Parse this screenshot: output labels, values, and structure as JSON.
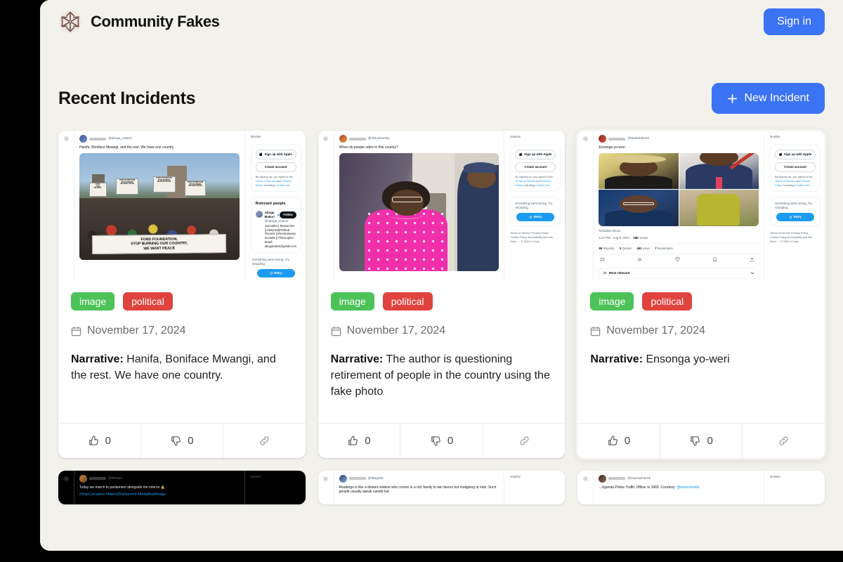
{
  "header": {
    "brand_name": "Community Fakes",
    "logo_icon": "pinwheel-logo-icon",
    "signin_label": "Sign in"
  },
  "section": {
    "title": "Recent Incidents",
    "new_incident_label": "New Incident",
    "plus_icon": "plus-icon"
  },
  "colors": {
    "page_background": "#f2f1ec",
    "card_background": "#ffffff",
    "accent_blue": "#3b73f5",
    "tag_image_green": "#4cc258",
    "tag_political_red": "#e0433d",
    "brand_logo_brown": "#7a5c52",
    "twitter_blue": "#1d9bf0",
    "muted_text": "#536471"
  },
  "shared_tweet_sidebar": {
    "timeline_word": "timeline",
    "signup_apple": "Sign up with Apple",
    "create_account": "Create account",
    "legal_prefix": "By signing up, you agree to the ",
    "legal_tos": "Terms of Service",
    "legal_and": " and ",
    "legal_privacy": "Privacy Policy",
    "legal_mid": ", including ",
    "legal_cookie": "Cookie Use",
    "legal_end": ".",
    "relevant_people_heading": "Relevant people",
    "error_text": "Something went wrong. Try reloading.",
    "retry_label": "Retry",
    "footer_line1": "Terms of Service   Privacy Policy",
    "footer_line2": "Cookie Policy   Accessibility   Ads info",
    "footer_line3": "More …    © 2024 X Corp."
  },
  "cards": [
    {
      "id": "card-1",
      "highlighted": false,
      "tweet": {
        "handle": "@abuga_makori",
        "text": "Hanifa, Boniface Mwangi, and the rest. We have one country.",
        "media_type": "single-photo",
        "photo_alt": "protest-crowd-photo",
        "placards": [
          "FORD FOUNDATION, STOP BURNING OUR COUNTRY, WE WANT PEACE"
        ],
        "banner_line1": "FORD FOUNDATION,",
        "banner_line2": "STOP BURNING OUR COUNTRY,",
        "banner_line3": "WE WANT PEACE",
        "relevant_person": {
          "name": "Abuga Makori",
          "handle": "@abuga_makori",
          "follow_label": "Follow",
          "bio": "Journalist || Researcher || Historian||Political Theorist || Revolutionary Socialist || Philosopher. Email: abuganakori@gmail.com"
        }
      },
      "tags": [
        "image",
        "political"
      ],
      "date": "November 17, 2024",
      "narrative_label": "Narrative:",
      "narrative": "Hanifa, Boniface Mwangi, and the rest. We have one country.",
      "upvotes": "0",
      "downvotes": "0",
      "link_icon": "link-icon"
    },
    {
      "id": "card-2",
      "highlighted": false,
      "tweet": {
        "handle": "@AkLanGeeky",
        "text": "When do people retire in this country?",
        "media_type": "single-photo",
        "photo_alt": "elderly-woman-in-pink-dress-photo"
      },
      "tags": [
        "image",
        "political"
      ],
      "date": "November 17, 2024",
      "narrative_label": "Narrative:",
      "narrative": "The author is questioning retirement of people in the country using the fake photo",
      "upvotes": "0",
      "downvotes": "0",
      "link_icon": "link-icon"
    },
    {
      "id": "card-3",
      "highlighted": true,
      "tweet": {
        "handle": "@Ntabeleke22",
        "text": "Ensonga yo-weri.",
        "media_type": "four-photo-grid",
        "photo_alt": "four-portraits-grid",
        "source_label": "Nshabwe Bruce",
        "timestamp": "5:10 PM · Aug 8, 2024",
        "views": "18K",
        "views_label": "Views",
        "reposts_count": "96",
        "reposts_label": "Reposts",
        "quotes_count": "3",
        "quotes_label": "Quotes",
        "likes_count": "461",
        "likes_label": "Likes",
        "bookmarks_count": "7",
        "bookmarks_label": "Bookmarks",
        "sort_label": "Most relevant"
      },
      "tags": [
        "image",
        "political"
      ],
      "date": "November 17, 2024",
      "narrative_label": "Narrative:",
      "narrative": "Ensonga yo-weri",
      "upvotes": "0",
      "downvotes": "0",
      "link_icon": "link-icon"
    }
  ],
  "next_row_preview": [
    {
      "id": "card-4",
      "dark": true,
      "handle": "@BPUsm",
      "text": "Today we march to parliament alongside the interns 🔒",
      "hashtags": "#StopCorruption #March2Parliament #AnitaMustResign",
      "side_word": "timeline"
    },
    {
      "id": "card-5",
      "dark": false,
      "handle": "@IBug256",
      "text": "Rwabogo is like a distant relative who comes in a rich family to win favors but maligning ur kids. Such people usually speak candid but",
      "side_word": "timeline"
    },
    {
      "id": "card-6",
      "dark": false,
      "handle": "@OyasiuPatrick",
      "text": "...Uganda Police Traffic Officer in 1965. Courtesy:",
      "mention": "@telxonkadde",
      "side_word": "timeline"
    }
  ]
}
